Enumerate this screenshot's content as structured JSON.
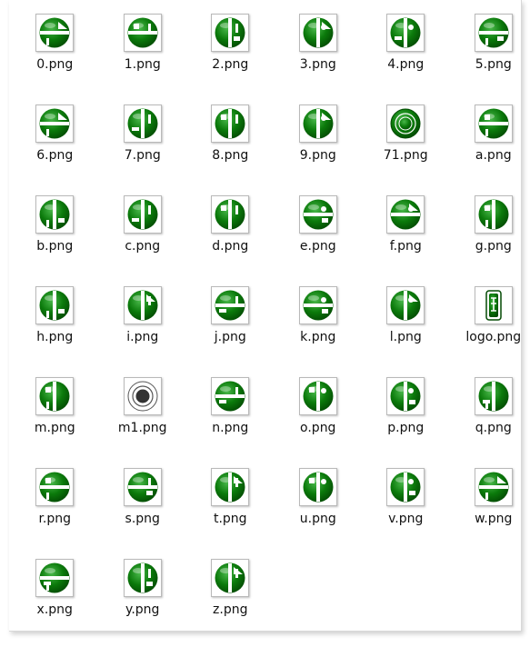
{
  "files": [
    {
      "name": "0.png",
      "icon": "glyph-0-icon"
    },
    {
      "name": "1.png",
      "icon": "glyph-1-icon"
    },
    {
      "name": "2.png",
      "icon": "glyph-2-icon"
    },
    {
      "name": "3.png",
      "icon": "glyph-3-icon"
    },
    {
      "name": "4.png",
      "icon": "glyph-4-icon"
    },
    {
      "name": "5.png",
      "icon": "glyph-5-icon"
    },
    {
      "name": "6.png",
      "icon": "glyph-6-icon"
    },
    {
      "name": "7.png",
      "icon": "glyph-7-icon"
    },
    {
      "name": "8.png",
      "icon": "glyph-8-icon"
    },
    {
      "name": "9.png",
      "icon": "glyph-9-icon"
    },
    {
      "name": "71.png",
      "icon": "glyph-71-icon"
    },
    {
      "name": "a.png",
      "icon": "glyph-a-icon"
    },
    {
      "name": "b.png",
      "icon": "glyph-b-icon"
    },
    {
      "name": "c.png",
      "icon": "glyph-c-icon"
    },
    {
      "name": "d.png",
      "icon": "glyph-d-icon"
    },
    {
      "name": "e.png",
      "icon": "glyph-e-icon"
    },
    {
      "name": "f.png",
      "icon": "glyph-f-icon"
    },
    {
      "name": "g.png",
      "icon": "glyph-g-icon"
    },
    {
      "name": "h.png",
      "icon": "glyph-h-icon"
    },
    {
      "name": "i.png",
      "icon": "glyph-i-icon"
    },
    {
      "name": "j.png",
      "icon": "glyph-j-icon"
    },
    {
      "name": "k.png",
      "icon": "glyph-k-icon"
    },
    {
      "name": "l.png",
      "icon": "glyph-l-icon"
    },
    {
      "name": "logo.png",
      "icon": "logo-icon"
    },
    {
      "name": "m.png",
      "icon": "glyph-m-icon"
    },
    {
      "name": "m1.png",
      "icon": "glyph-m1-icon"
    },
    {
      "name": "n.png",
      "icon": "glyph-n-icon"
    },
    {
      "name": "o.png",
      "icon": "glyph-o-icon"
    },
    {
      "name": "p.png",
      "icon": "glyph-p-icon"
    },
    {
      "name": "q.png",
      "icon": "glyph-q-icon"
    },
    {
      "name": "r.png",
      "icon": "glyph-r-icon"
    },
    {
      "name": "s.png",
      "icon": "glyph-s-icon"
    },
    {
      "name": "t.png",
      "icon": "glyph-t-icon"
    },
    {
      "name": "u.png",
      "icon": "glyph-u-icon"
    },
    {
      "name": "v.png",
      "icon": "glyph-v-icon"
    },
    {
      "name": "w.png",
      "icon": "glyph-w-icon"
    },
    {
      "name": "x.png",
      "icon": "glyph-x-icon"
    },
    {
      "name": "y.png",
      "icon": "glyph-y-icon"
    },
    {
      "name": "z.png",
      "icon": "glyph-z-icon"
    }
  ],
  "colors": {
    "glyph_green": "#0b7a0b",
    "glyph_dark": "#034a03",
    "glyph_light": "#49b84a"
  }
}
